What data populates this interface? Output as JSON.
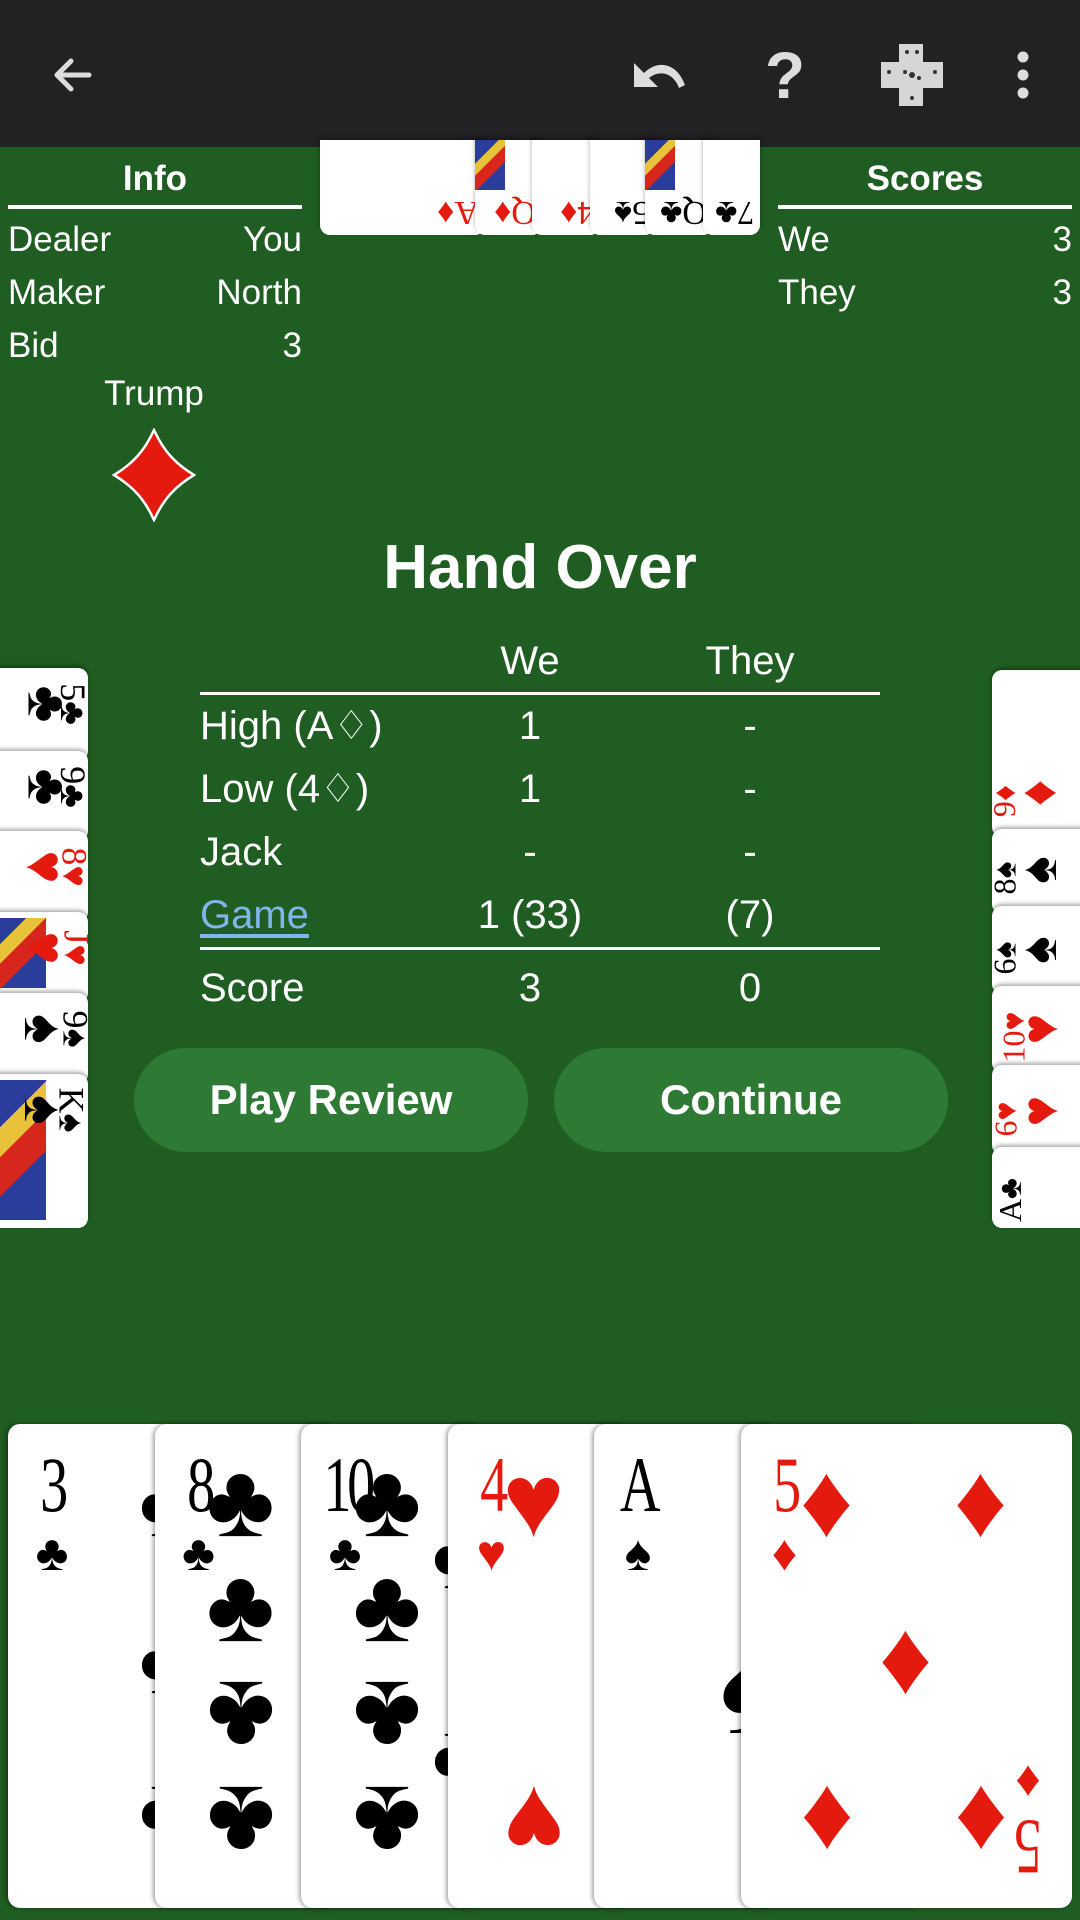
{
  "toolbar": {
    "icons": [
      "arrow-back-icon",
      "undo-icon",
      "help-icon",
      "card-layout-icon",
      "more-vert-icon"
    ],
    "help_glyph": "?"
  },
  "info": {
    "title": "Info",
    "rows": [
      {
        "label": "Dealer",
        "value": "You"
      },
      {
        "label": "Maker",
        "value": "North"
      },
      {
        "label": "Bid",
        "value": "3"
      }
    ],
    "trump_label": "Trump",
    "trump_suit": "diamonds"
  },
  "scores": {
    "title": "Scores",
    "rows": [
      {
        "label": "We",
        "value": "3"
      },
      {
        "label": "They",
        "value": "3"
      }
    ]
  },
  "result": {
    "title": "Hand Over",
    "header": [
      "",
      "We",
      "They"
    ],
    "rows": [
      {
        "label": "High (A♢)",
        "we": "1",
        "they": "-"
      },
      {
        "label": "Low (4♢)",
        "we": "1",
        "they": "-"
      },
      {
        "label": "Jack",
        "we": "-",
        "they": "-"
      },
      {
        "label": "Game",
        "we": "1 (33)",
        "they": "(7)"
      }
    ],
    "score": {
      "label": "Score",
      "we": "3",
      "they": "0"
    }
  },
  "buttons": {
    "play_review": "Play Review",
    "continue": "Continue"
  },
  "colors": {
    "felt": "#1f5d22",
    "toolbar": "#222124",
    "button": "#2e7a34",
    "link": "#82b5ec",
    "red_suit": "#e51a0e"
  },
  "hands": {
    "north": [
      {
        "rank": "A",
        "suit": "diamonds"
      },
      {
        "rank": "Q",
        "suit": "diamonds"
      },
      {
        "rank": "4",
        "suit": "diamonds"
      },
      {
        "rank": "5",
        "suit": "spades"
      },
      {
        "rank": "Q",
        "suit": "clubs"
      },
      {
        "rank": "7",
        "suit": "clubs"
      }
    ],
    "west": [
      {
        "rank": "5",
        "suit": "clubs"
      },
      {
        "rank": "9",
        "suit": "clubs"
      },
      {
        "rank": "8",
        "suit": "hearts"
      },
      {
        "rank": "J",
        "suit": "hearts"
      },
      {
        "rank": "9",
        "suit": "spades"
      },
      {
        "rank": "K",
        "suit": "spades"
      }
    ],
    "east": [
      {
        "rank": "9",
        "suit": "diamonds"
      },
      {
        "rank": "8",
        "suit": "spades"
      },
      {
        "rank": "6",
        "suit": "spades"
      },
      {
        "rank": "10",
        "suit": "hearts"
      },
      {
        "rank": "6",
        "suit": "hearts"
      },
      {
        "rank": "A",
        "suit": "clubs"
      }
    ],
    "south": [
      {
        "rank": "3",
        "suit": "clubs"
      },
      {
        "rank": "8",
        "suit": "clubs"
      },
      {
        "rank": "10",
        "suit": "clubs"
      },
      {
        "rank": "4",
        "suit": "hearts"
      },
      {
        "rank": "A",
        "suit": "spades"
      },
      {
        "rank": "5",
        "suit": "diamonds"
      }
    ]
  }
}
